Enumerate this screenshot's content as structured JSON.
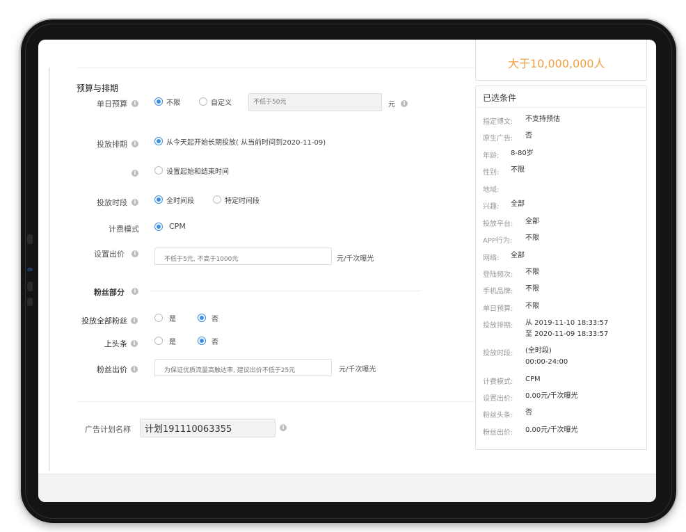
{
  "form": {
    "section_budget": "预算与排期",
    "daily_budget_label": "单日预算",
    "budget_options": [
      "不限",
      "自定义"
    ],
    "budget_placeholder": "不低于50元",
    "budget_unit": "元",
    "schedule_label": "投放排期",
    "schedule_option1": "从今天起开始长期投放( 从当前时间到2020-11-09)",
    "schedule_option2": "设置起始和结束时间",
    "time_label": "投放时段",
    "time_options": [
      "全时间段",
      "特定时间段"
    ],
    "billing_label": "计费模式",
    "billing_option": "CPM",
    "bid_label": "设置出价",
    "bid_placeholder": "不低于5元, 不高于1000元",
    "bid_unit": "元/千次曝光",
    "section_fans": "粉丝部分",
    "all_fans_label": "投放全部粉丝",
    "headline_label": "上头条",
    "yes": "是",
    "no": "否",
    "fans_bid_label": "粉丝出价",
    "fans_bid_placeholder": "为保证优质流量高触达率, 建议出价不低于25元",
    "fans_bid_unit": "元/千次曝光",
    "plan_name_label": "广告计划名称",
    "plan_name_value": "计划191110063355"
  },
  "summary": {
    "top_partial": "大于10,000,000人",
    "title": "已选条件",
    "rows": [
      {
        "k": "指定博文:",
        "v": "不支持预估"
      },
      {
        "k": "原生广告:",
        "v": "否"
      },
      {
        "k": "年龄:",
        "v": "8-80岁"
      },
      {
        "k": "性别:",
        "v": "不限"
      },
      {
        "k": "地域:",
        "v": ""
      },
      {
        "k": "兴趣:",
        "v": "全部"
      },
      {
        "k": "投放平台:",
        "v": "全部"
      },
      {
        "k": "APP行为:",
        "v": "不限"
      },
      {
        "k": "网络:",
        "v": "全部"
      },
      {
        "k": "登陆频次:",
        "v": "不限"
      },
      {
        "k": "手机品牌:",
        "v": "不限"
      },
      {
        "k": "单日预算:",
        "v": "不限"
      },
      {
        "k": "投放排期:",
        "v": "从 2019-11-10 18:33:57",
        "v2": "至 2020-11-09 18:33:57"
      },
      {
        "k": "投放时段:",
        "v": "(全时段)",
        "v2": "00:00-24:00"
      },
      {
        "k": "计费模式:",
        "v": "CPM"
      },
      {
        "k": "设置出价:",
        "v": "0.00元/千次曝光"
      },
      {
        "k": "粉丝头条:",
        "v": "否"
      },
      {
        "k": "粉丝出价:",
        "v": "0.00元/千次曝光"
      }
    ]
  }
}
